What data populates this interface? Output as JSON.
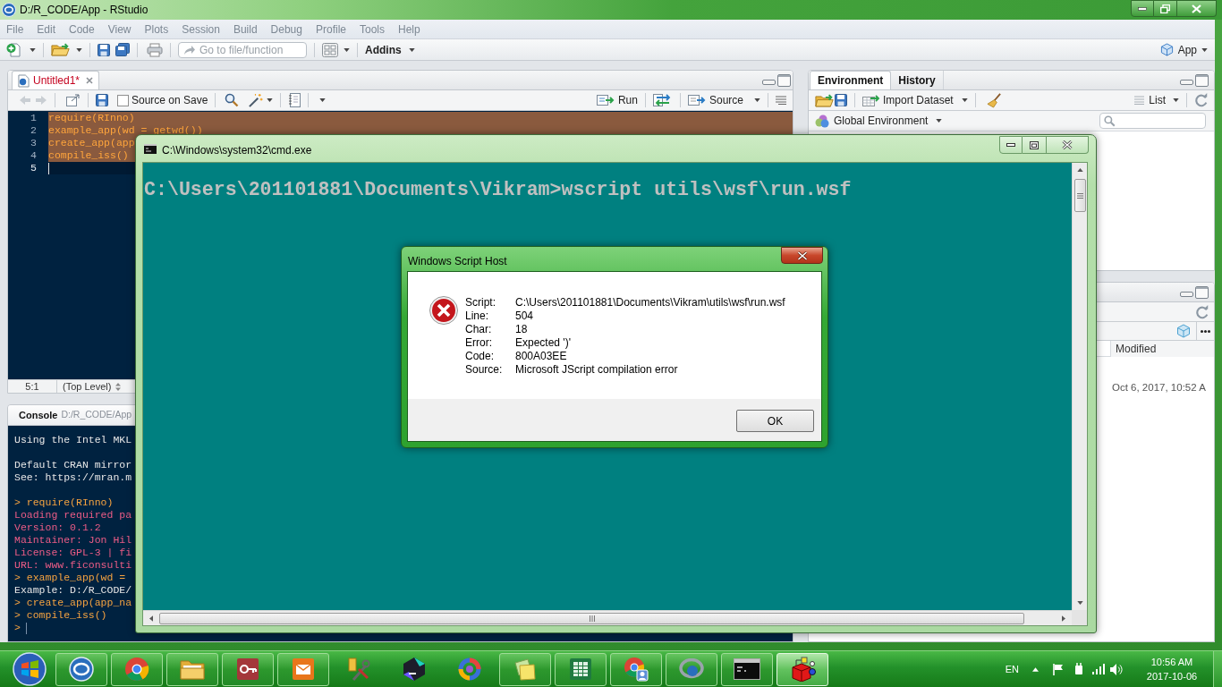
{
  "rstudio": {
    "title": "D:/R_CODE/App - RStudio",
    "menu": [
      "File",
      "Edit",
      "Code",
      "View",
      "Plots",
      "Session",
      "Build",
      "Debug",
      "Profile",
      "Tools",
      "Help"
    ],
    "goto_placeholder": "Go to file/function",
    "addins": "Addins",
    "project": "App"
  },
  "editor": {
    "tabs": [
      {
        "label": "Untitled1*",
        "modified": true,
        "selected": true
      }
    ],
    "back": {
      "disabled": true
    },
    "forward": {
      "disabled": true
    },
    "source_on_save": {
      "label": "Source on Save",
      "checked": false
    },
    "run": "Run",
    "source": "Source",
    "lines": [
      {
        "number": "1",
        "code": "require(RInno)",
        "selected": true
      },
      {
        "number": "2",
        "code": "example_app(wd = getwd())",
        "selected": true
      },
      {
        "number": "3",
        "code": "create_app(app",
        "selected": true
      },
      {
        "number": "4",
        "code": "compile_iss()",
        "selected": true
      },
      {
        "number": "5",
        "selected": false,
        "cursor": true
      }
    ],
    "status": {
      "position": "5:1",
      "scope": "(Top Level)"
    }
  },
  "console": {
    "title": "Console",
    "path": "D:/R_CODE/App",
    "blocks": [
      {
        "lines": [
          {
            "kind": "output",
            "text": "Using the Intel MKL"
          }
        ]
      },
      {
        "lines": [
          {
            "kind": "output",
            "text": "Default CRAN mirror"
          },
          {
            "kind": "output",
            "text": "See: https://mran.m"
          }
        ]
      },
      {
        "lines": [
          {
            "kind": "input",
            "text": "> require(RInno)"
          },
          {
            "kind": "message",
            "text": "Loading required pa"
          },
          {
            "kind": "message",
            "text": "Version: 0.1.2"
          },
          {
            "kind": "message",
            "text": "Maintainer: Jon Hil"
          },
          {
            "kind": "message",
            "text": "License: GPL-3 | fi"
          },
          {
            "kind": "message",
            "text": "URL: www.ficonsulti"
          },
          {
            "kind": "input",
            "text": "> example_app(wd ="
          },
          {
            "kind": "output",
            "text": "Example: D:/R_CODE/"
          },
          {
            "kind": "input",
            "text": "> create_app(app_na"
          },
          {
            "kind": "input",
            "text": "> compile_iss()"
          },
          {
            "kind": "input",
            "text": ">",
            "cursor": true
          }
        ]
      }
    ]
  },
  "environment": {
    "tabs": [
      {
        "label": "Environment",
        "selected": true
      },
      {
        "label": "History",
        "selected": false
      }
    ],
    "import": "Import Dataset",
    "view": "List",
    "scope": "Global Environment"
  },
  "files": {
    "columns": [
      "Modified"
    ],
    "rows": [
      {
        "cells": [
          "Oct 6, 2017, 10:52 A"
        ]
      }
    ]
  },
  "terminal": {
    "title": "C:\\Windows\\system32\\cmd.exe",
    "lines": [
      "C:\\Users\\201101881\\Documents\\Vikram>wscript utils\\wsf\\run.wsf"
    ]
  },
  "dialog": {
    "title": "Windows Script Host",
    "kind": "error",
    "fields": [
      {
        "label": "Script:",
        "value": "C:\\Users\\201101881\\Documents\\Vikram\\utils\\wsf\\run.wsf"
      },
      {
        "label": "Line:",
        "value": "504"
      },
      {
        "label": "Char:",
        "value": "18"
      },
      {
        "label": "Error:",
        "value": "Expected ')'"
      },
      {
        "label": "Code:",
        "value": "800A03EE"
      },
      {
        "label": "Source:",
        "value": "Microsoft JScript compilation error"
      }
    ],
    "button": "OK"
  },
  "taskbar": {
    "buttons": [
      {
        "kind": "r-logo",
        "running": true,
        "active": false
      },
      {
        "kind": "browser",
        "running": true,
        "active": false
      },
      {
        "kind": "folder",
        "running": true,
        "active": false
      },
      {
        "kind": "database",
        "running": true,
        "active": false
      },
      {
        "kind": "mail",
        "running": true,
        "active": false
      },
      {
        "kind": "tools",
        "running": false,
        "active": false
      },
      {
        "kind": "go",
        "running": false,
        "active": false
      },
      {
        "kind": "ring",
        "running": false,
        "active": false
      },
      {
        "kind": "notes",
        "running": true,
        "active": false
      },
      {
        "kind": "spreadsheet",
        "running": true,
        "active": false
      },
      {
        "kind": "browser-user",
        "running": true,
        "active": false
      },
      {
        "kind": "r-desktop",
        "running": true,
        "active": false
      },
      {
        "kind": "terminal",
        "running": true,
        "active": false
      },
      {
        "kind": "cube",
        "running": true,
        "active": true
      }
    ],
    "language": "EN",
    "time": "10:56 AM",
    "date": "2017-10-06"
  }
}
